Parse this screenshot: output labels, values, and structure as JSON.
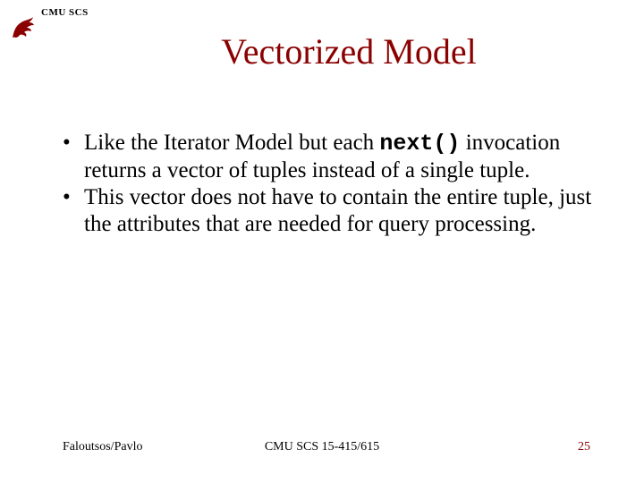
{
  "header": {
    "org": "CMU SCS"
  },
  "title": "Vectorized Model",
  "bullets": [
    {
      "pre": "Like the Iterator Model but each ",
      "code": "next()",
      "post": " invocation returns a vector of tuples instead of a single tuple."
    },
    {
      "pre": "This vector does not have to contain the entire tuple, just the attributes that are needed for query processing.",
      "code": "",
      "post": ""
    }
  ],
  "footer": {
    "left": "Faloutsos/Pavlo",
    "center": "CMU SCS 15-415/615",
    "right": "25"
  }
}
